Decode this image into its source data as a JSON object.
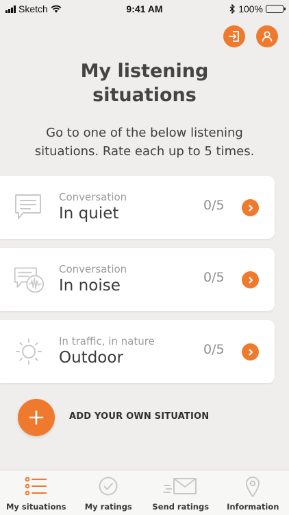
{
  "status_bar": {
    "carrier": "Sketch",
    "time": "9:41 AM",
    "battery": "100%"
  },
  "header": {
    "exit_icon": "exit-icon",
    "profile_icon": "profile-icon",
    "title_line1": "My listening",
    "title_line2": "situations",
    "subtitle_line1": "Go to one of the below listening",
    "subtitle_line2": "situations. Rate each up to 5 times."
  },
  "situations": [
    {
      "kicker": "Conversation",
      "title": "In quiet",
      "count": "0/5",
      "icon": "speech-bubble-icon"
    },
    {
      "kicker": "Conversation",
      "title": "In noise",
      "count": "0/5",
      "icon": "noisy-speech-icon"
    },
    {
      "kicker": "In traffic, in nature",
      "title": "Outdoor",
      "count": "0/5",
      "icon": "sun-icon"
    }
  ],
  "add_situation": {
    "label": "ADD YOUR OWN SITUATION",
    "icon": "plus-icon"
  },
  "tabs": [
    {
      "label": "My situations",
      "icon": "list-icon",
      "active": true
    },
    {
      "label": "My ratings",
      "icon": "check-circle-icon",
      "active": false
    },
    {
      "label": "Send ratings",
      "icon": "envelope-icon",
      "active": false
    },
    {
      "label": "Information",
      "icon": "location-pin-icon",
      "active": false
    }
  ],
  "colors": {
    "accent": "#ef7a2d",
    "background": "#efeeec",
    "card": "#ffffff",
    "muted_icon": "#c8c8c8"
  }
}
